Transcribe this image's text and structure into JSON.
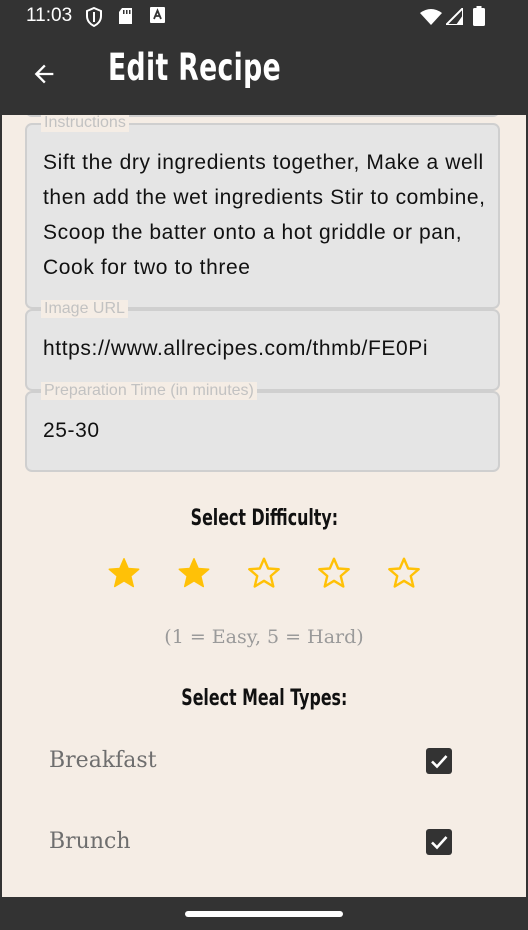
{
  "status_bar": {
    "time": "11:03",
    "left_icons": [
      "shield-icon",
      "sd-card-icon",
      "text-notification-icon"
    ],
    "right_icons": [
      "wifi-icon",
      "signal-icon",
      "battery-icon"
    ]
  },
  "app_bar": {
    "title": "Edit Recipe",
    "back_icon": "arrow-back-icon"
  },
  "form": {
    "instructions": {
      "label": "Instructions",
      "value": "Sift the dry ingredients together, Make a well then add the wet ingredients Stir to combine, Scoop the batter onto a hot griddle or pan, Cook for two to three"
    },
    "image_url": {
      "label": "Image URL",
      "value": "https://www.allrecipes.com/thmb/FE0Pi"
    },
    "prep_time": {
      "label": "Preparation Time (in minutes)",
      "value": "25-30"
    }
  },
  "difficulty": {
    "heading": "Select Difficulty:",
    "rating": 2,
    "max": 5,
    "hint": "(1 = Easy, 5 = Hard)",
    "star_color": "#ffc107"
  },
  "meal_types": {
    "heading": "Select Meal Types:",
    "items": [
      {
        "label": "Breakfast",
        "checked": true
      },
      {
        "label": "Brunch",
        "checked": true
      }
    ]
  },
  "colors": {
    "app_bar": "#333333",
    "background": "#f5ede5",
    "field_fill": "#e5e5e5"
  }
}
